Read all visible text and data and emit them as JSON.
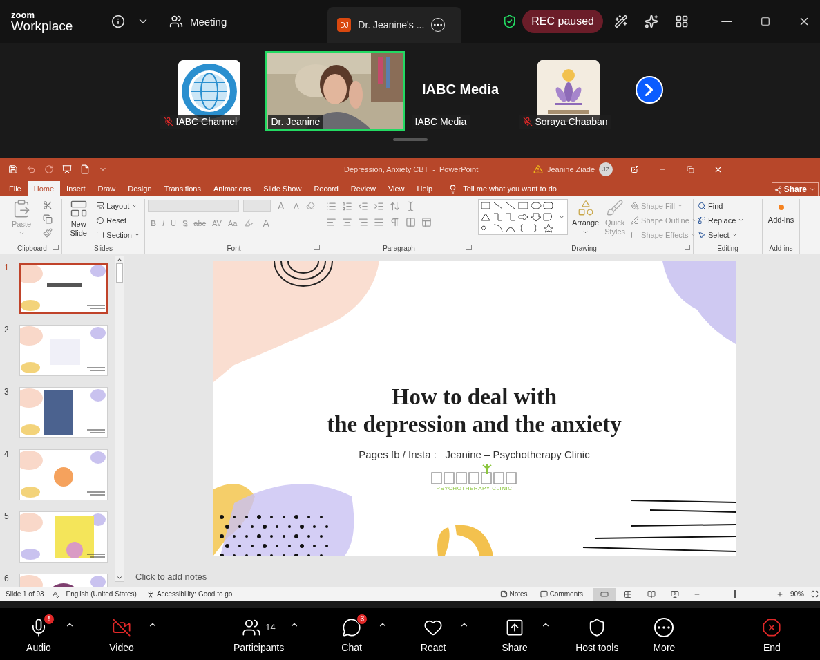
{
  "zoom_bar": {
    "logo_top": "zoom",
    "logo_bottom": "Workplace",
    "meeting_label": "Meeting",
    "tab": {
      "avatar": "DJ",
      "title": "Dr. Jeanine's ..."
    },
    "recording": "REC paused"
  },
  "participants": [
    {
      "name": "IABC Channel",
      "kind": "globe",
      "muted": true,
      "speaking": false
    },
    {
      "name": "Dr. Jeanine",
      "kind": "video",
      "muted": false,
      "speaking": true
    },
    {
      "name": "IABC Media",
      "kind": "name",
      "title": "IABC Media",
      "muted": false,
      "speaking": false
    },
    {
      "name": "Soraya Chaaban",
      "kind": "lotus",
      "muted": true,
      "speaking": false
    }
  ],
  "powerpoint": {
    "title": "Depression, Anxiety CBT  -  PowerPoint",
    "user": "Jeanine Ziade",
    "user_initials": "JZ",
    "tabs": [
      {
        "label": "File",
        "selected": false
      },
      {
        "label": "Home",
        "selected": true
      },
      {
        "label": "Insert",
        "selected": false
      },
      {
        "label": "Draw",
        "selected": false
      },
      {
        "label": "Design",
        "selected": false
      },
      {
        "label": "Transitions",
        "selected": false
      },
      {
        "label": "Animations",
        "selected": false
      },
      {
        "label": "Slide Show",
        "selected": false
      },
      {
        "label": "Record",
        "selected": false
      },
      {
        "label": "Review",
        "selected": false
      },
      {
        "label": "View",
        "selected": false
      },
      {
        "label": "Help",
        "selected": false
      }
    ],
    "tell_me": "Tell me what you want to do",
    "share": "Share",
    "ribbon": {
      "clipboard": {
        "label": "Clipboard",
        "paste": {
          "label": "Paste",
          "disabled": true
        }
      },
      "slides": {
        "label": "Slides",
        "new_slide": "New Slide",
        "commands": [
          {
            "label": "Layout",
            "caret": true
          },
          {
            "label": "Reset",
            "caret": false
          },
          {
            "label": "Section",
            "caret": true
          }
        ]
      },
      "font": {
        "label": "Font",
        "disabled": true,
        "size_buttons": [
          "A",
          "A"
        ],
        "format_buttons": [
          "B",
          "I",
          "U",
          "S",
          "abc",
          "AV",
          "Aa"
        ],
        "color_button": "A"
      },
      "paragraph": {
        "label": "Paragraph"
      },
      "drawing": {
        "label": "Drawing",
        "arrange": "Arrange",
        "quick_styles": {
          "label": "Quick Styles",
          "disabled": true
        },
        "shape_commands": [
          {
            "label": "Shape Fill",
            "disabled": true
          },
          {
            "label": "Shape Outline",
            "disabled": true
          },
          {
            "label": "Shape Effects",
            "disabled": true
          }
        ]
      },
      "editing": {
        "label": "Editing",
        "commands": [
          {
            "label": "Find",
            "caret": false
          },
          {
            "label": "Replace",
            "caret": true
          },
          {
            "label": "Select",
            "caret": true
          }
        ]
      },
      "addins": {
        "label": "Add-ins",
        "button": "Add-ins"
      }
    },
    "thumbnails": [
      {
        "number": "1",
        "selected": true
      },
      {
        "number": "2",
        "selected": false
      },
      {
        "number": "3",
        "selected": false
      },
      {
        "number": "4",
        "selected": false
      },
      {
        "number": "5",
        "selected": false
      },
      {
        "number": "6",
        "selected": false
      }
    ],
    "slide": {
      "title_lines": [
        "How to deal with",
        "the depression and the anxiety"
      ],
      "subtitle": "Pages fb / Insta :   Jeanine – Psychotherapy Clinic",
      "logo_caption": "PSYCHOTHERAPY CLINIC"
    },
    "notes_placeholder": "Click to add notes",
    "status_bar": {
      "slide": "Slide 1 of 93",
      "language": "English (United States)",
      "accessibility": "Accessibility: Good to go",
      "notes": "Notes",
      "comments": "Comments",
      "views": [
        {
          "selected": true
        },
        {
          "selected": false
        },
        {
          "selected": false
        },
        {
          "selected": false
        }
      ],
      "zoom": {
        "level": 0.45,
        "reading": "90%"
      }
    }
  },
  "toolbar": [
    {
      "label": "Audio",
      "badge": "!",
      "caret": true
    },
    {
      "label": "Video",
      "on": false,
      "caret": true
    },
    {
      "label": "Participants",
      "count": "14",
      "caret": true
    },
    {
      "label": "Chat",
      "badge": "3",
      "caret": true
    },
    {
      "label": "React",
      "caret": true
    },
    {
      "label": "Share",
      "caret": true
    },
    {
      "label": "Host tools",
      "caret": false
    },
    {
      "label": "More",
      "caret": false
    },
    {
      "label": "End",
      "caret": false
    }
  ]
}
